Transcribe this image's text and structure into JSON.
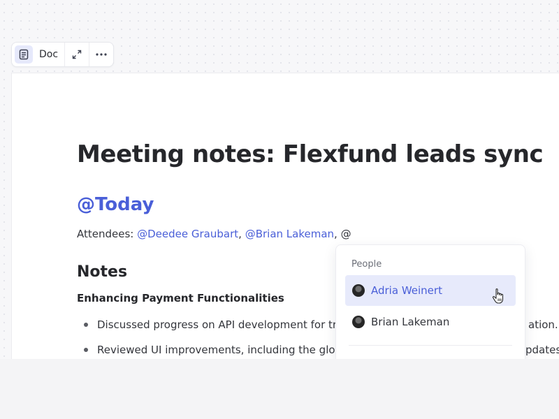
{
  "toolbar": {
    "doc_label": "Doc",
    "icons": [
      "document-icon",
      "expand-icon",
      "more-icon"
    ]
  },
  "document": {
    "title": "Meeting notes: Flexfund leads sync",
    "date_mention": "@Today",
    "attendees_prefix": "Attendees: ",
    "attendees": [
      "@Deedee Graubart",
      "@Brian Lakeman"
    ],
    "separator": ", ",
    "mention_trigger": "@",
    "notes_heading": "Notes",
    "subheading": "Enhancing Payment Functionalities",
    "bullets": [
      {
        "left": "Discussed progress on API development for tr",
        "right": "ation."
      },
      {
        "left": "Reviewed UI improvements, including the glob",
        "right": "pdates"
      }
    ]
  },
  "mention_popup": {
    "header": "People",
    "items": [
      {
        "name": "Adria Weinert",
        "selected": true
      },
      {
        "name": "Brian Lakeman",
        "selected": false
      }
    ]
  },
  "colors": {
    "accent": "#4a5fd8",
    "selected_bg": "#e7eafb",
    "text": "#26272b"
  }
}
